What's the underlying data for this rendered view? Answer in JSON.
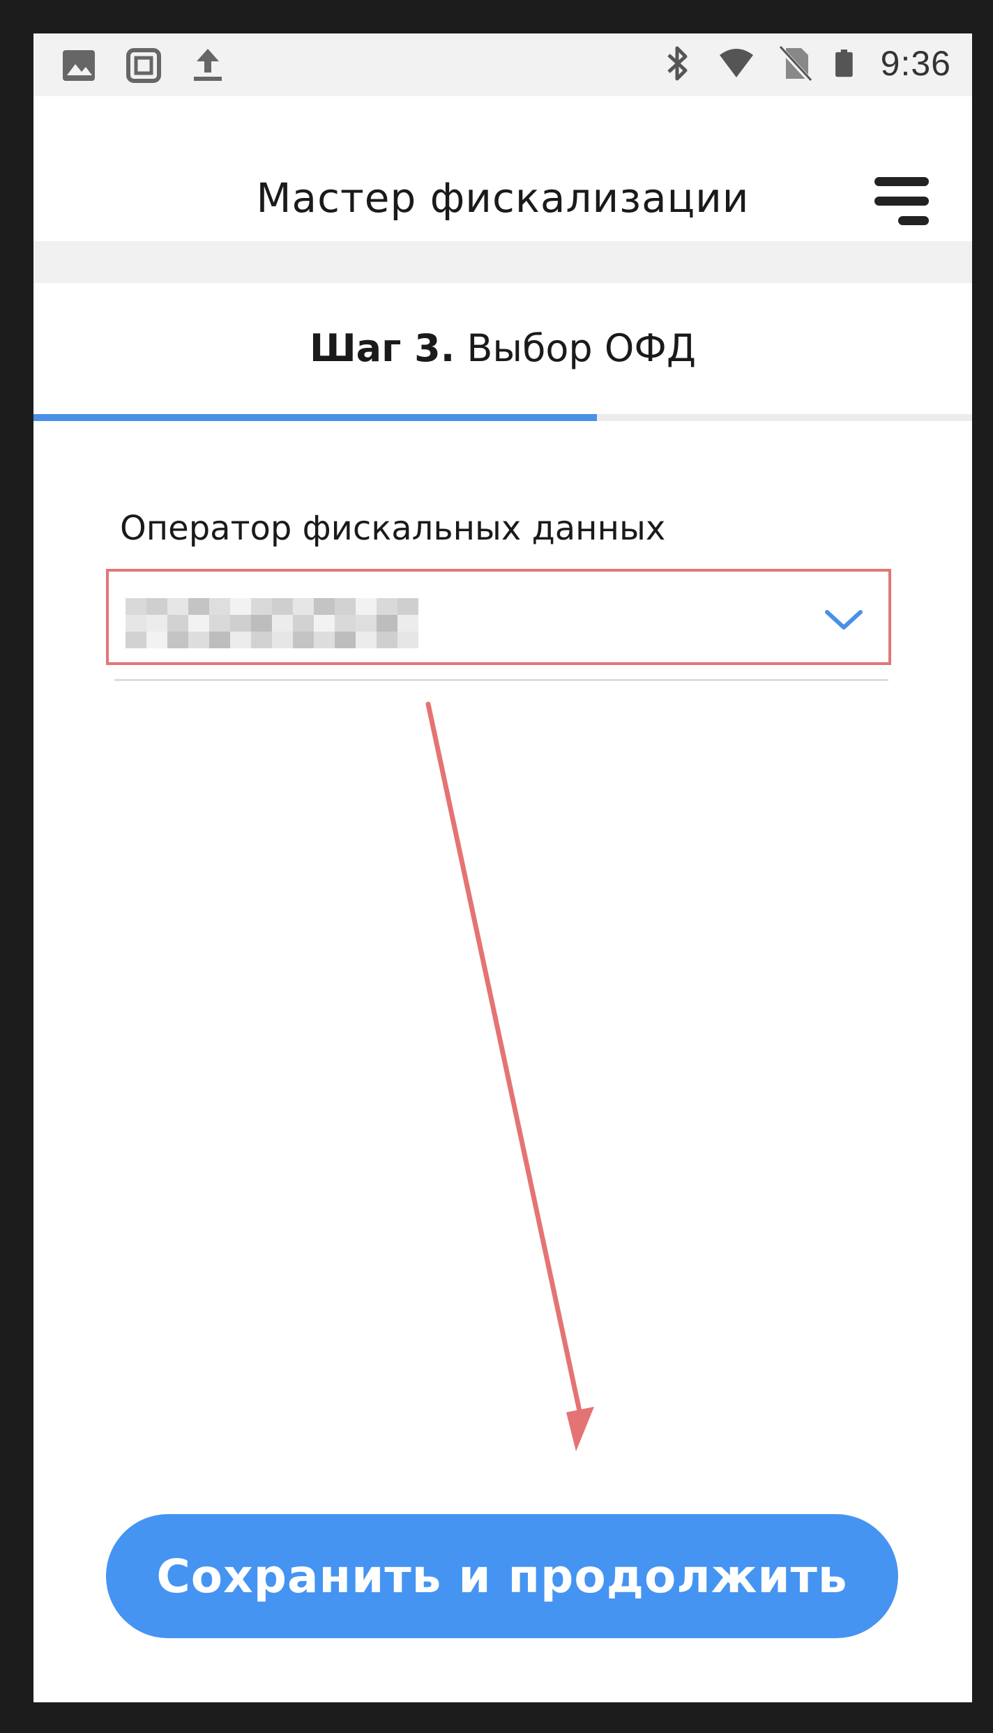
{
  "status_bar": {
    "left_icons": [
      "image-icon",
      "screenshot-frame-icon",
      "upload-icon"
    ],
    "right_icons": [
      "bluetooth-icon",
      "wifi-icon",
      "no-sim-icon",
      "battery-icon"
    ],
    "time": "9:36"
  },
  "header": {
    "title": "Мастер фискализации",
    "menu_icon": "menu-icon"
  },
  "step": {
    "number_label": "Шаг 3.",
    "title": "Выбор ОФД",
    "progress": 0.6
  },
  "form": {
    "ofd_label": "Оператор фискальных данных",
    "ofd_value_state": "blurred",
    "dropdown_icon": "chevron-down-icon"
  },
  "actions": {
    "save_label": "Сохранить и продолжить"
  },
  "colors": {
    "accent": "#4594f2",
    "progress": "#4a90e6",
    "highlight": "#e37676",
    "annotation_arrow": "#e57373"
  }
}
